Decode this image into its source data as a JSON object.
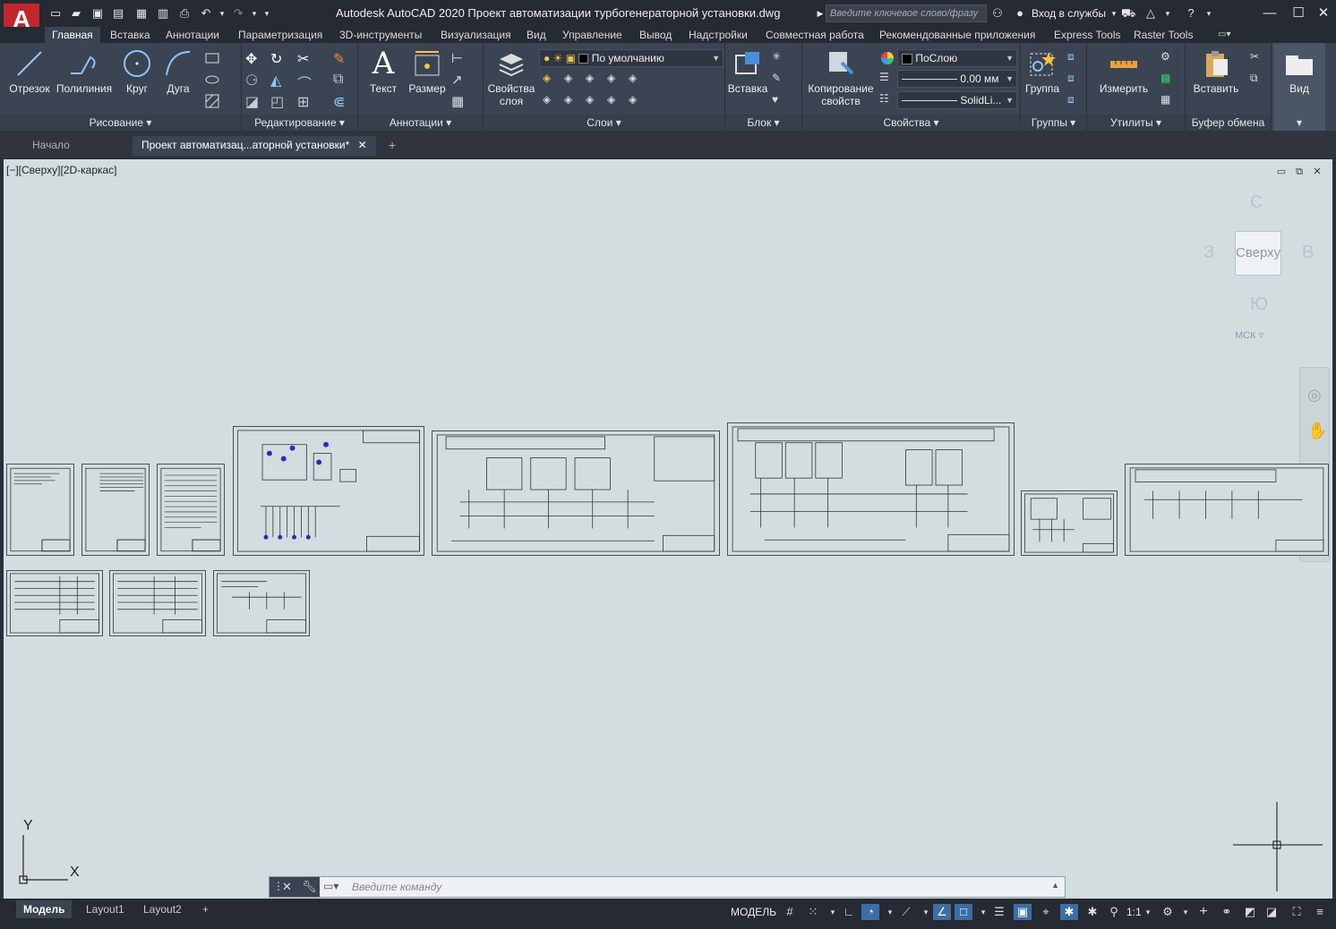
{
  "app": {
    "title": "Autodesk AutoCAD 2020   Проект автоматизации турбогенераторной установки.dwg",
    "logo_letter": "A",
    "search_placeholder": "Введите ключевое слово/фразу",
    "login_label": "Вход в службы"
  },
  "ribbon_tabs": [
    "Главная",
    "Вставка",
    "Аннотации",
    "Параметризация",
    "3D-инструменты",
    "Визуализация",
    "Вид",
    "Управление",
    "Вывод",
    "Надстройки",
    "Совместная работа",
    "Рекомендованные приложения",
    "Express Tools",
    "Raster Tools"
  ],
  "ribbon": {
    "draw": {
      "title": "Рисование",
      "line": "Отрезок",
      "polyline": "Полилиния",
      "circle": "Круг",
      "arc": "Дуга"
    },
    "modify": {
      "title": "Редактирование"
    },
    "annotation": {
      "title": "Аннотации",
      "text": "Текст",
      "dimension": "Размер"
    },
    "layers": {
      "title": "Слои",
      "layer_props": "Свойства слоя",
      "layer_combo": "По умолчанию"
    },
    "block": {
      "title": "Блок",
      "insert": "Вставка"
    },
    "properties": {
      "title": "Свойства",
      "match": "Копирование свойств",
      "color": "ПоСлою",
      "lineweight": "0.00 мм",
      "linetype": "SolidLi..."
    },
    "groups": {
      "title": "Группы",
      "group": "Группа"
    },
    "utilities": {
      "title": "Утилиты",
      "measure": "Измерить"
    },
    "clipboard": {
      "title": "Буфер обмена",
      "paste": "Вставить"
    },
    "view": {
      "title": "Вид"
    }
  },
  "doc_tabs": {
    "start": "Начало",
    "active": "Проект автоматизац...аторной установки*"
  },
  "viewport": {
    "label": "[−][Сверху][2D-каркас]",
    "compass": {
      "north": "С",
      "south": "Ю",
      "west": "З",
      "east": "В",
      "face": "Сверху",
      "ucs": "МСК"
    },
    "axis_x": "X",
    "axis_y": "Y"
  },
  "command": {
    "placeholder": "Введите команду"
  },
  "status": {
    "tabs": [
      "Модель",
      "Layout1",
      "Layout2"
    ],
    "model_label": "МОДЕЛЬ",
    "scale": "1:1"
  }
}
